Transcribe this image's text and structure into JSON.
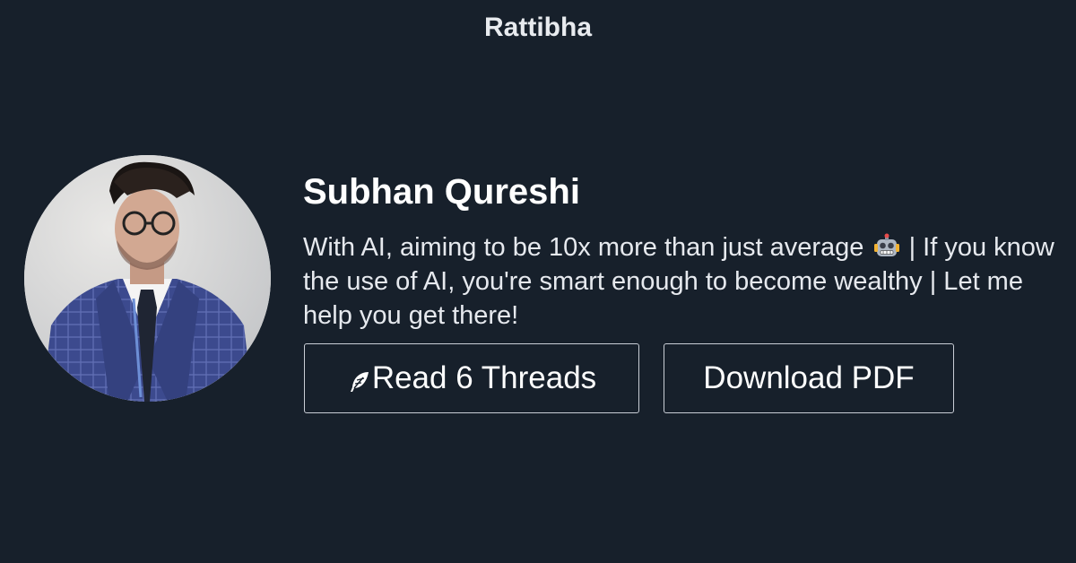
{
  "header": {
    "brand": "Rattibha"
  },
  "profile": {
    "name": "Subhan Qureshi",
    "bio_part1": "With AI, aiming to be 10x more than just average",
    "bio_emoji": "robot-emoji-icon",
    "bio_part2": "| If you know the use of AI, you're smart enough to become wealthy | Let me help you get there!",
    "avatar_icon": "profile-photo"
  },
  "actions": {
    "read_icon": "feather-icon",
    "read_label": "Read 6 Threads",
    "pdf_label": "Download PDF"
  },
  "colors": {
    "background": "#17202b",
    "text": "#ffffff",
    "button_border": "#c9ced6"
  }
}
